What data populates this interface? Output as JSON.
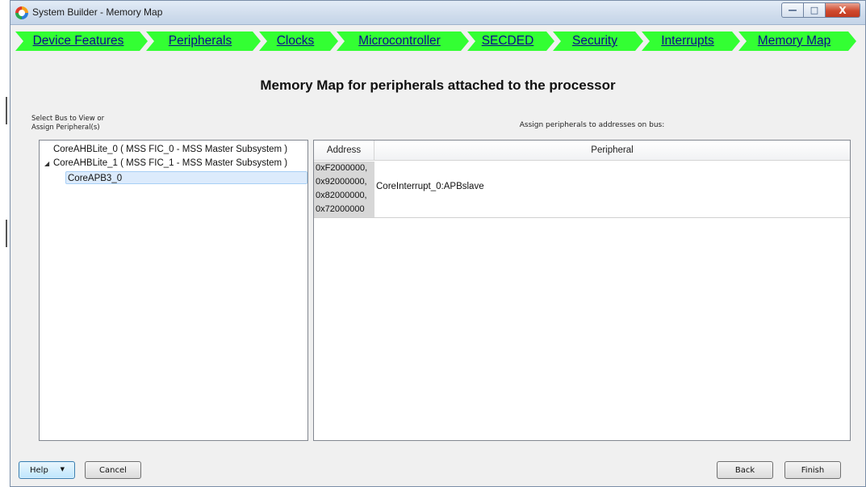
{
  "window": {
    "title": "System Builder - Memory Map",
    "buttons": {
      "minimize": "—",
      "maximize": "□",
      "close": "X"
    }
  },
  "wizard": {
    "steps": [
      {
        "label": "Device Features",
        "current": false
      },
      {
        "label": "Peripherals",
        "current": false
      },
      {
        "label": "Clocks",
        "current": false
      },
      {
        "label": "Microcontroller",
        "current": false
      },
      {
        "label": "SECDED",
        "current": false
      },
      {
        "label": "Security",
        "current": false
      },
      {
        "label": "Interrupts",
        "current": false
      },
      {
        "label": "Memory Map",
        "current": true
      }
    ],
    "step_color": "#33ff33",
    "step_text_color": "#0a0a8c"
  },
  "heading": "Memory Map for peripherals attached to the processor",
  "left_panel": {
    "caption_line1": "Select Bus to View or",
    "caption_line2": "Assign Peripheral(s)",
    "tree": [
      {
        "label": "CoreAHBLite_0  ( MSS FIC_0 - MSS Master Subsystem )",
        "level": 0,
        "expanded": false,
        "selected": false
      },
      {
        "label": "CoreAHBLite_1  ( MSS FIC_1 - MSS Master Subsystem )",
        "level": 0,
        "expanded": true,
        "selected": false
      },
      {
        "label": "CoreAPB3_0",
        "level": 1,
        "expanded": false,
        "selected": true
      }
    ]
  },
  "right_panel": {
    "caption": "Assign peripherals to addresses on bus:",
    "columns": [
      "Address",
      "Peripheral"
    ],
    "rows": [
      {
        "address": [
          "0xF2000000,",
          "0x92000000,",
          "0x82000000,",
          "0x72000000"
        ],
        "peripheral": "CoreInterrupt_0:APBslave"
      }
    ]
  },
  "footer": {
    "help": "Help",
    "help_caret": "▼",
    "cancel": "Cancel",
    "back": "Back",
    "finish": "Finish"
  }
}
